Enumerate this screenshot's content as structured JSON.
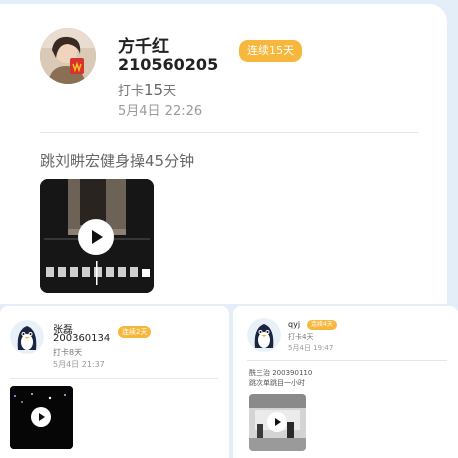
{
  "main_post": {
    "name": "方千红",
    "student_id": "210560205",
    "badge": "连续15天",
    "checkin_prefix": "打卡",
    "checkin_count": "15",
    "checkin_suffix": "天",
    "datetime": "5月4日 22:26",
    "title": "跳刘畊宏健身操45分钟"
  },
  "left_post": {
    "name": "张磊",
    "student_id": "200360134",
    "badge": "连续2天",
    "checkin": "打卡8天",
    "datetime": "5月4日 21:37"
  },
  "right_post": {
    "name": "qyj",
    "badge": "连续4天",
    "checkin": "打卡4天",
    "datetime": "5月4日 19:47",
    "title_line1": "酰三治 200390110",
    "title_line2": "跳次单跳目一小时"
  },
  "colors": {
    "badge": "#f6b73c",
    "background": "#e4eef8"
  },
  "icons": [
    "play-icon",
    "penguin-avatar-icon"
  ]
}
